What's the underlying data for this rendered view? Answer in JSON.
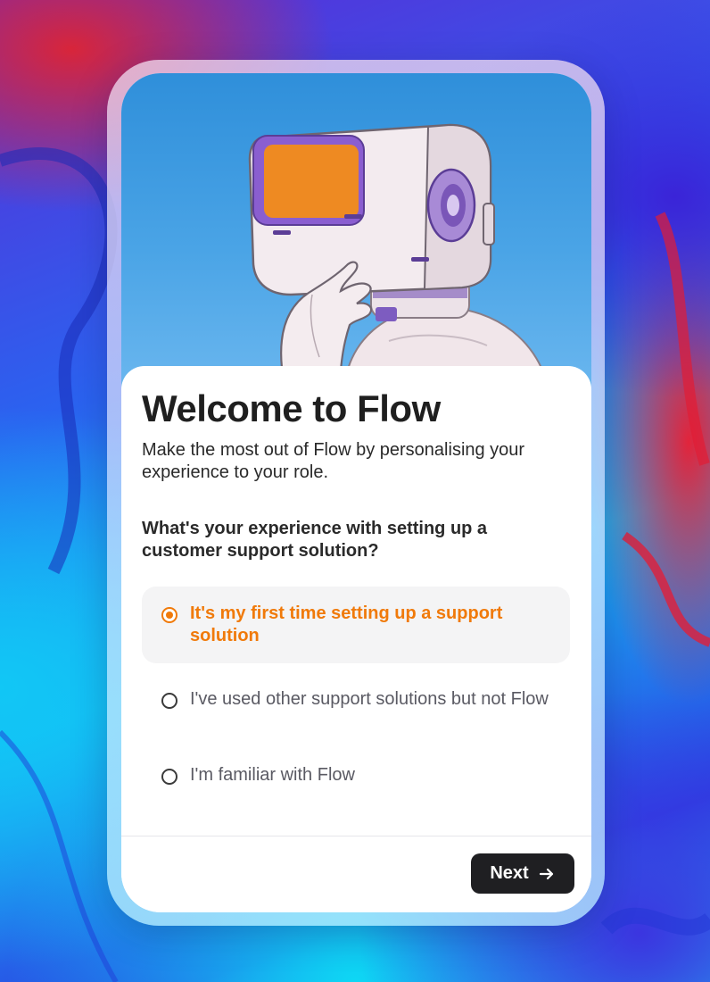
{
  "onboarding": {
    "title": "Welcome to Flow",
    "subtitle": "Make the most out of Flow by personalising your experience to your role.",
    "question": "What's your experience with setting up a customer support solution?",
    "options": [
      {
        "label": "It's my first time setting up a support solution",
        "selected": true
      },
      {
        "label": "I've used other support solutions but not Flow",
        "selected": false
      },
      {
        "label": "I'm familiar with Flow",
        "selected": false
      }
    ],
    "next_label": "Next"
  },
  "colors": {
    "accent": "#f07a0a",
    "button_bg": "#1f1f22",
    "hero_sky": "#2f8fda"
  },
  "icons": {
    "next_icon": "arrow-right-icon",
    "hero_image": "robot-illustration"
  }
}
